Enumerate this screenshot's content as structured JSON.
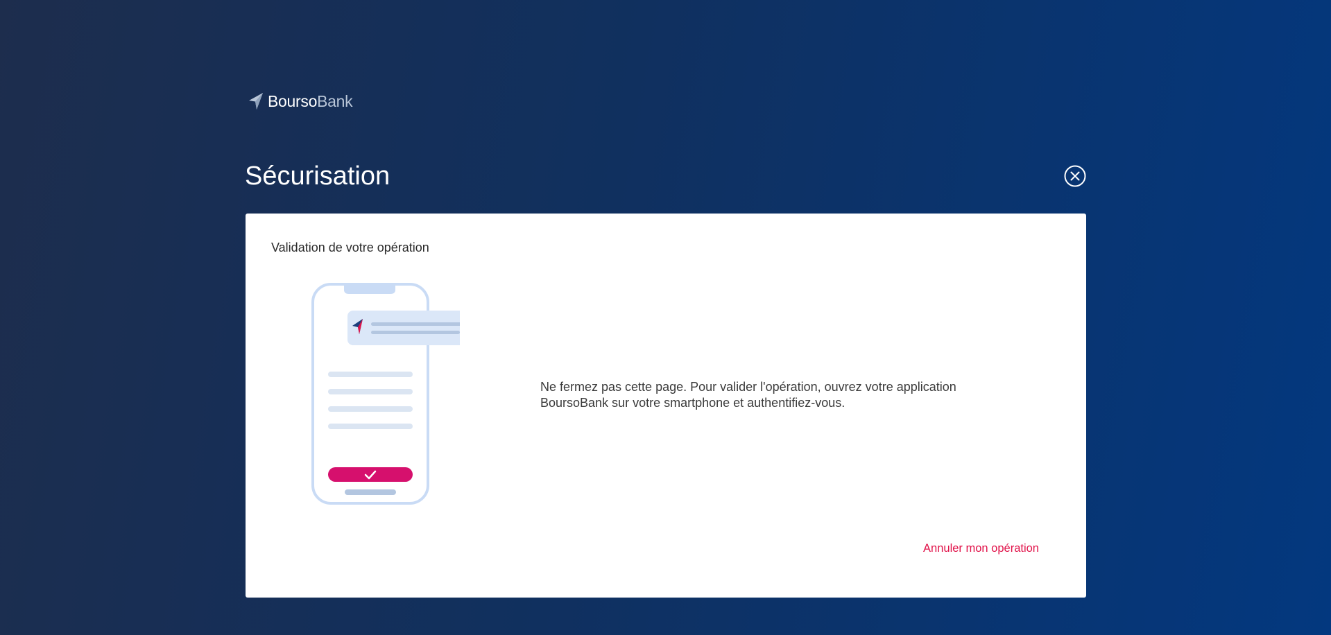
{
  "brand": {
    "name_strong": "Bourso",
    "name_light": "Bank",
    "logo_icon": "boursobank-arrow-logo"
  },
  "header": {
    "title": "Sécurisation",
    "close_icon": "close-circle-icon"
  },
  "card": {
    "subtitle": "Validation de votre opération",
    "illustration_icon": "smartphone-validation-illustration",
    "message": "Ne fermez pas cette page. Pour valider l'opération, ouvrez votre application BoursoBank sur votre smartphone et authentifiez-vous.",
    "cancel_label": "Annuler mon opération"
  },
  "colors": {
    "background_start": "#1d2d4d",
    "background_end": "#03387f",
    "card_background": "#ffffff",
    "accent_pink": "#d6106d",
    "link_red": "#e1134a",
    "illustration_blue": "#c9dbf5"
  }
}
